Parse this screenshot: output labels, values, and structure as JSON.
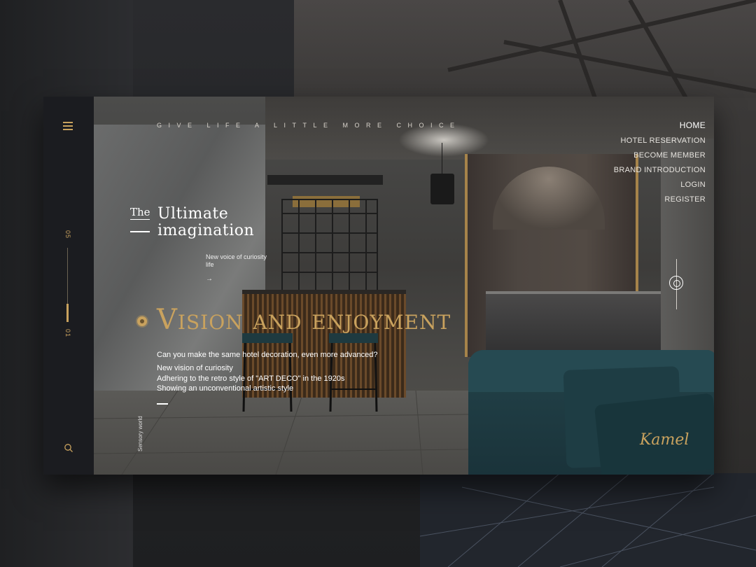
{
  "hero": {
    "tagline": "GIVE LIFE A LITTLE MORE CHOICE",
    "the_label": "The",
    "headline_line1": "Ultimate",
    "headline_line2": "imagination",
    "subnote": "New voice of curiosity life",
    "arrow_symbol": "→",
    "title": "Vision and enjoyment",
    "question": "Can you make the same hotel decoration, even more advanced?",
    "lines": [
      "New vision of curiosity",
      "Adhering to the retro style of \"ART DECO\" in the 1920s",
      "Showing an unconventional artistic style"
    ],
    "sensory_label": "Sensory world",
    "brand_signature": "Kamel"
  },
  "nav": {
    "items": [
      {
        "label": "HOME",
        "active": true
      },
      {
        "label": "HOTEL RESERVATION",
        "active": false
      },
      {
        "label": "BECOME MEMBER",
        "active": false
      },
      {
        "label": "BRAND INTRODUCTION",
        "active": false
      },
      {
        "label": "LOGIN",
        "active": false
      },
      {
        "label": "REGISTER",
        "active": false
      }
    ]
  },
  "sidebar": {
    "page_total": "05",
    "page_current": "01",
    "menu_icon": "hamburger-menu-icon",
    "search_icon": "search-icon"
  },
  "colors": {
    "accent_gold": "#c9a25e",
    "sidebar_bg": "#1b1c20",
    "sofa_teal": "#23434a"
  }
}
